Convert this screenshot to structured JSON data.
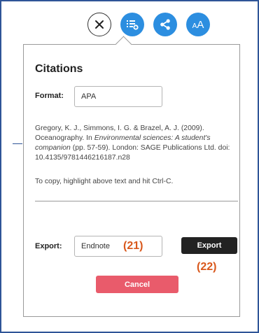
{
  "toolbar": {
    "icons": [
      "close-icon",
      "list-add-icon",
      "share-icon",
      "font-size-icon"
    ],
    "font_size_label": "AA",
    "accent_color": "#2c8ee0"
  },
  "citations": {
    "title": "Citations",
    "format_label": "Format:",
    "format_value": "APA",
    "citation_plain_1": "Gregory, K. J., Simmons, I. G. & Brazel, A. J. (2009). Oceanography. In ",
    "citation_italic": "Environmental sciences: A student's companion",
    "citation_plain_2": " (pp. 57-59). London: SAGE Publications Ltd. doi: 10.4135/9781446216187.n28",
    "hint": "To copy, highlight above text and hit Ctrl-C.",
    "export_label": "Export:",
    "export_value": "Endnote",
    "export_button": "Export",
    "cancel_button": "Cancel"
  },
  "annotations": {
    "field_marker": "(21)",
    "button_marker": "(22)",
    "color": "#d9581c"
  }
}
